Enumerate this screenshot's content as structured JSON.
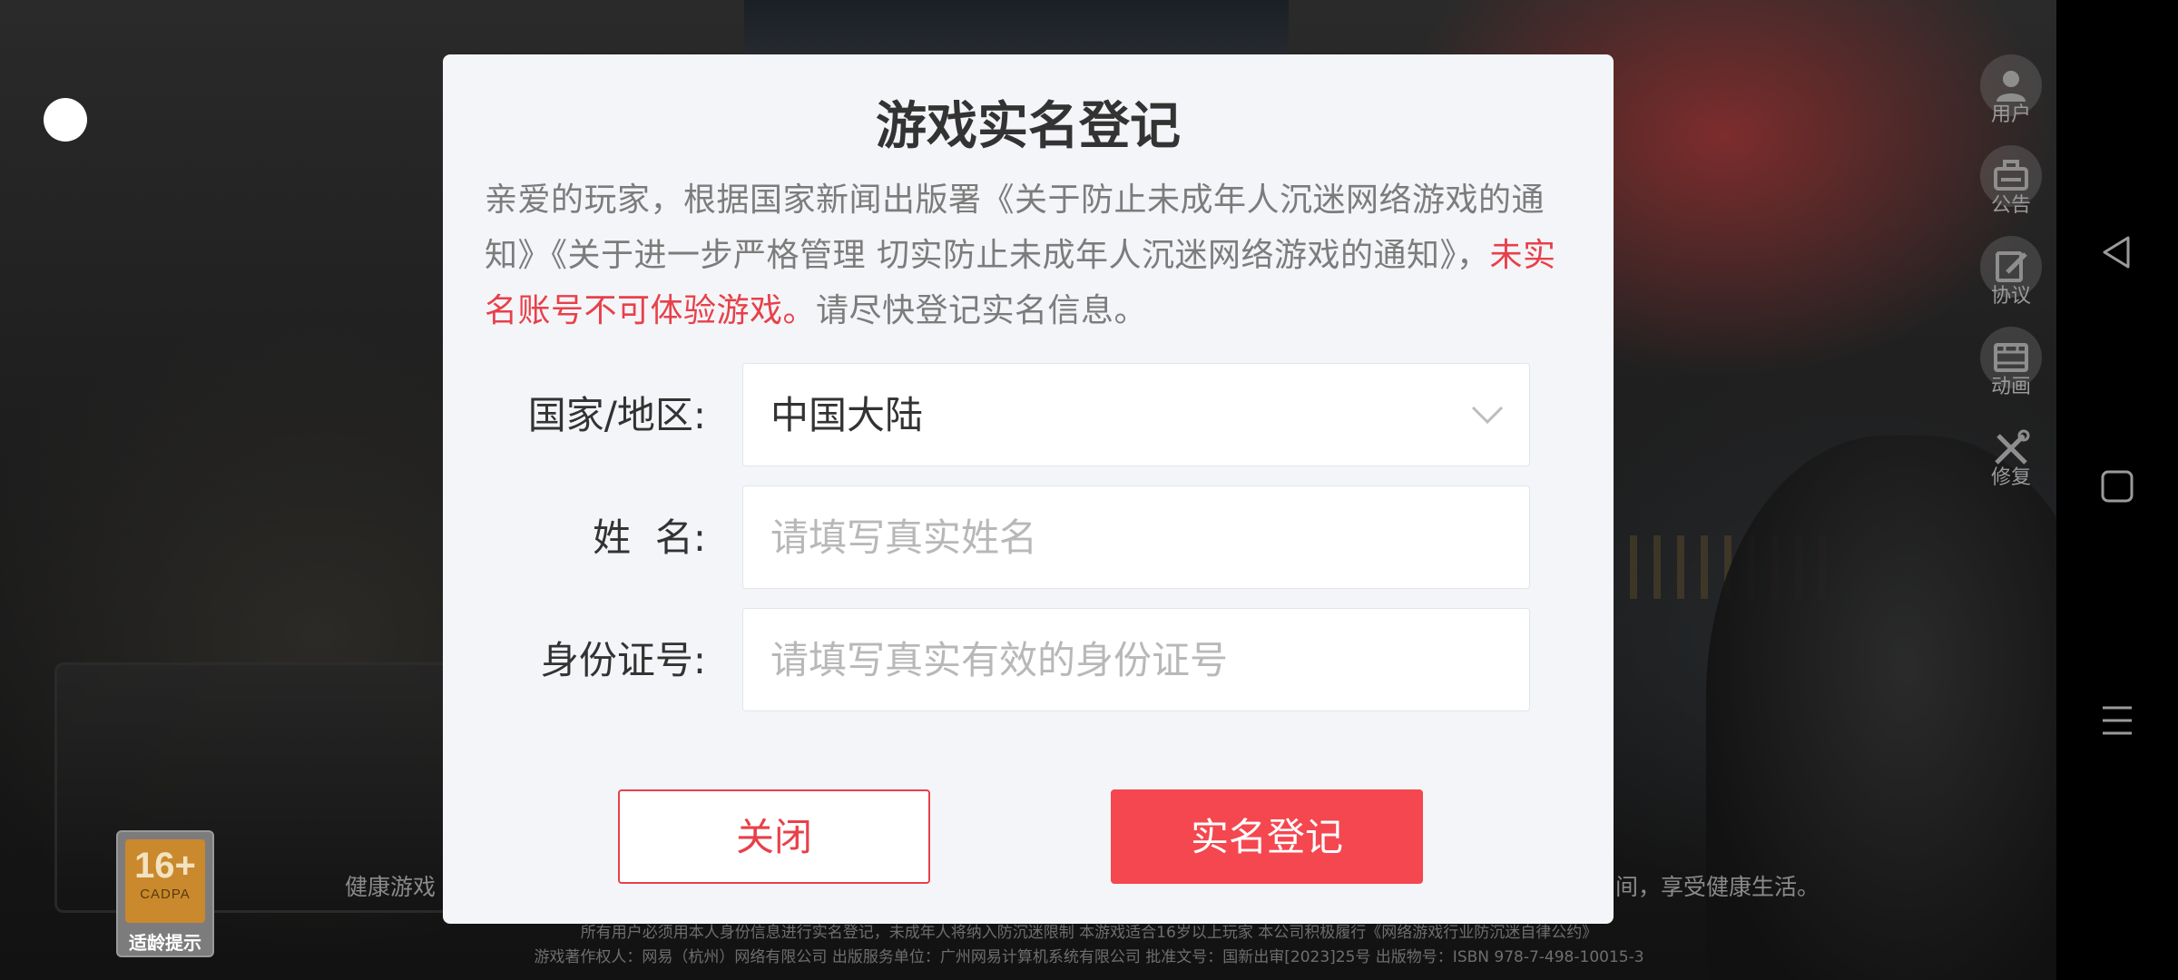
{
  "dialog": {
    "title": "游戏实名登记",
    "notice_before": "亲爱的玩家，根据国家新闻出版署《关于防止未成年人沉迷网络游戏的通知》《关于进一步严格管理 切实防止未成年人沉迷网络游戏的通知》，",
    "notice_warning": "未实名账号不可体验游戏。",
    "notice_after": "请尽快登记实名信息。",
    "country_label": "国家/地区:",
    "country_value": "中国大陆",
    "name_label": "姓  名:",
    "name_placeholder": "请填写真实姓名",
    "name_value": "",
    "id_label": "身份证号:",
    "id_placeholder": "请填写真实有效的身份证号",
    "id_value": "",
    "close_label": "关闭",
    "submit_label": "实名登记"
  },
  "side_tools": [
    {
      "label": "用户",
      "icon": "user-icon"
    },
    {
      "label": "公告",
      "icon": "announcement-icon"
    },
    {
      "label": "协议",
      "icon": "agreement-icon"
    },
    {
      "label": "动画",
      "icon": "animation-icon"
    },
    {
      "label": "修复",
      "icon": "repair-icon"
    }
  ],
  "age_badge": {
    "rating": "16+",
    "org": "CADPA",
    "label": "适龄提示"
  },
  "health_notice": {
    "left": "健康游戏",
    "right": "间，享受健康生活。"
  },
  "footer": {
    "line1": "所有用户必须用本人身份信息进行实名登记，未成年人将纳入防沉迷限制 本游戏适合16岁以上玩家 本公司积极履行《网络游戏行业防沉迷自律公约》",
    "line2": "游戏著作权人：网易（杭州）网络有限公司 出版服务单位：广州网易计算机系统有限公司 批准文号：国新出审[2023]25号 出版物号：ISBN 978-7-498-10015-3"
  },
  "colors": {
    "accent": "#f4474f",
    "warning_text": "#e8404a",
    "dialog_bg": "#f4f5f8"
  }
}
